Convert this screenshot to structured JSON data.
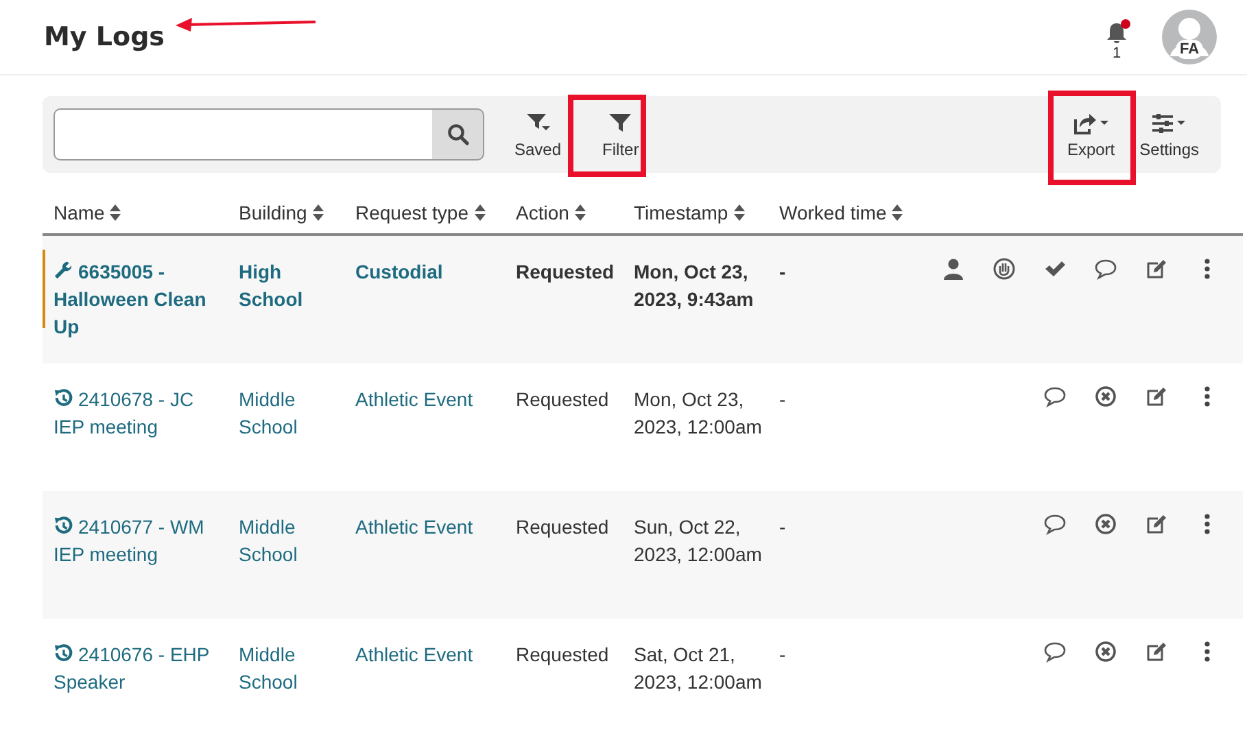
{
  "page_title": "My Logs",
  "notifications": {
    "count": "1",
    "unread": true
  },
  "user": {
    "initials": "FA"
  },
  "toolbar_left": [
    {
      "kind": "saved",
      "label": "Saved"
    },
    {
      "kind": "filter",
      "label": "Filter"
    }
  ],
  "toolbar_right": [
    {
      "kind": "export",
      "label": "Export"
    },
    {
      "kind": "settings",
      "label": "Settings"
    }
  ],
  "table": {
    "columns": [
      "Name",
      "Building",
      "Request type",
      "Action",
      "Timestamp",
      "Worked time"
    ],
    "rows": [
      {
        "kind": "work_order",
        "highlighted": true,
        "name": "6635005 - Halloween Clean Up",
        "building": "High School",
        "request_type": "Custodial",
        "action": "Requested",
        "timestamp": "Mon, Oct 23, 2023, 9:43am",
        "worked_time": "-"
      },
      {
        "kind": "event",
        "highlighted": false,
        "name": "2410678 - JC IEP meeting",
        "building": "Middle School",
        "request_type": "Athletic Event",
        "action": "Requested",
        "timestamp": "Mon, Oct 23, 2023, 12:00am",
        "worked_time": "-"
      },
      {
        "kind": "event",
        "highlighted": false,
        "name": "2410677 - WM IEP meeting",
        "building": "Middle School",
        "request_type": "Athletic Event",
        "action": "Requested",
        "timestamp": "Sun, Oct 22, 2023, 12:00am",
        "worked_time": "-"
      },
      {
        "kind": "event",
        "highlighted": false,
        "name": "2410676 - EHP Speaker",
        "building": "Middle School",
        "request_type": "Athletic Event",
        "action": "Requested",
        "timestamp": "Sat, Oct 21, 2023, 12:00am",
        "worked_time": "-"
      }
    ]
  }
}
